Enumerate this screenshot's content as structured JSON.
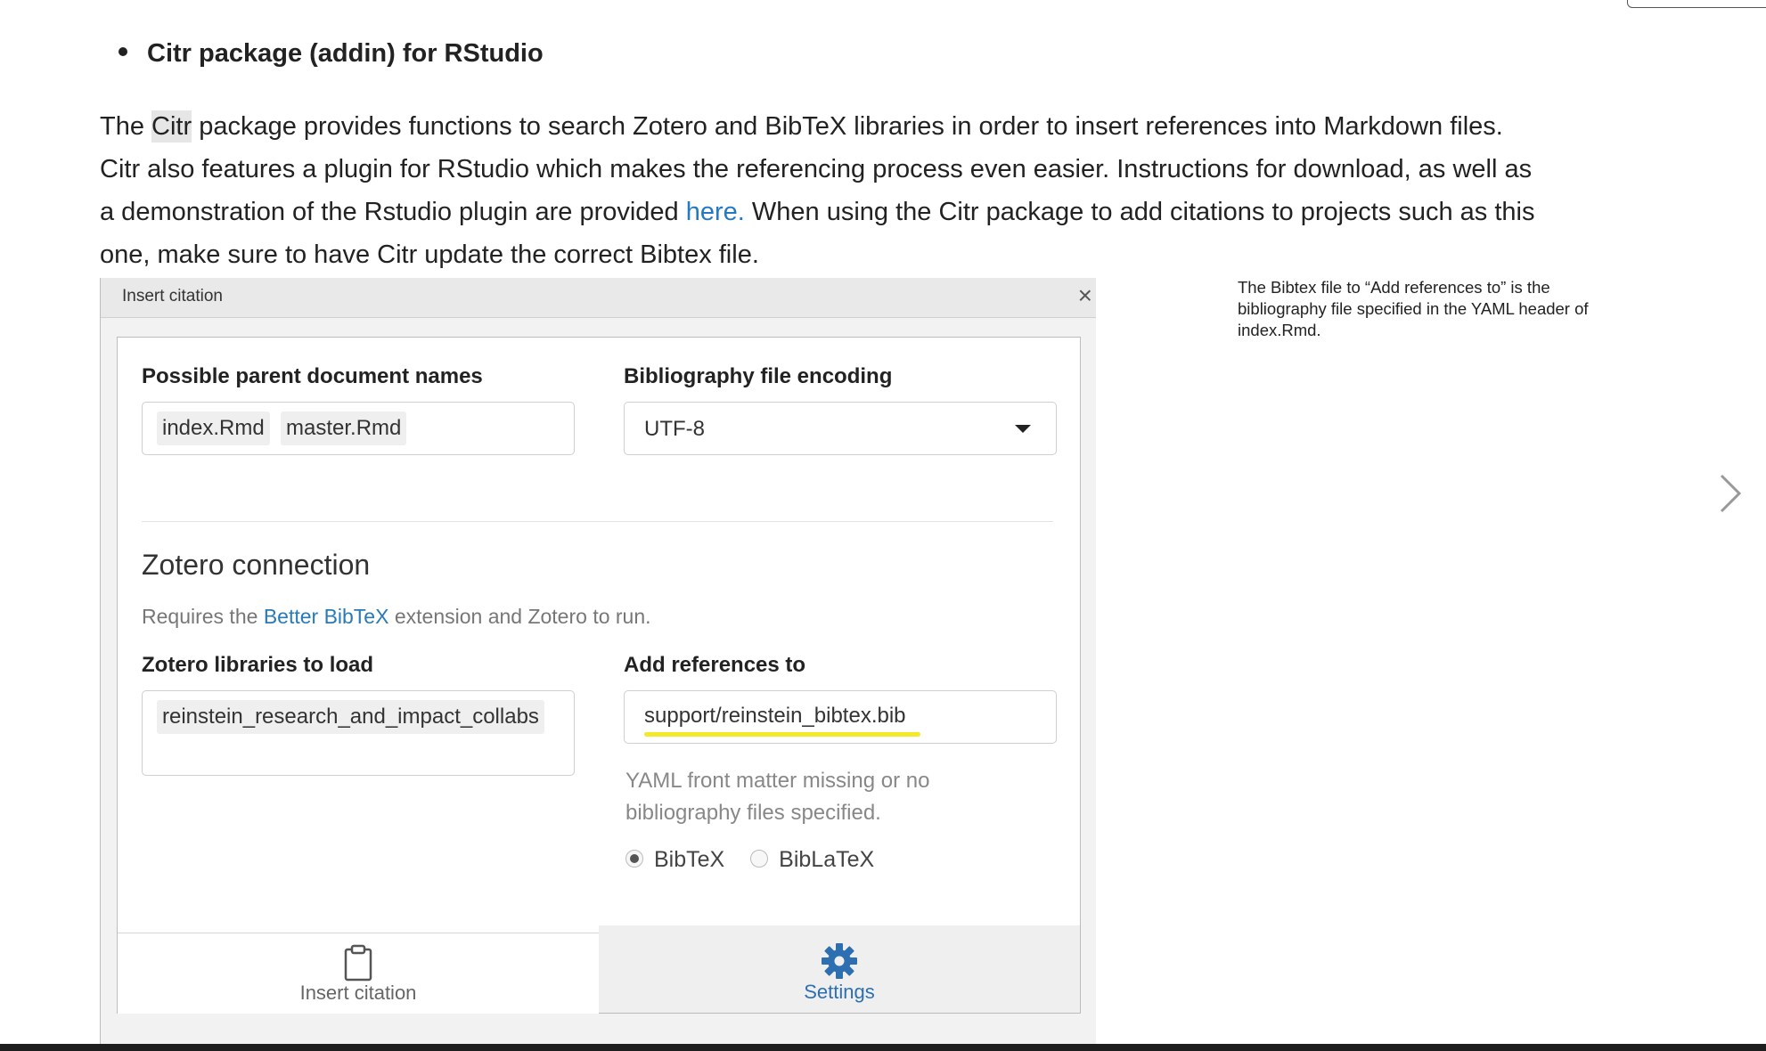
{
  "bullet": {
    "text": "Citr package (addin) for RStudio"
  },
  "paragraph": {
    "l1_pre": "The ",
    "l1_hl": "Citr",
    "l1_post": " package provides functions to search Zotero and BibTeX libraries in order to insert references into Markdown files.",
    "l2": "Citr also features a plugin for RStudio which makes the referencing process even easier. Instructions for download, as well as",
    "l3_pre": "a demonstration of the Rstudio plugin are provided ",
    "l3_link": "here.",
    "l3_post": " When using the Citr package to add citations to projects such as this",
    "l4": "one, make sure to have Citr update the correct Bibtex file."
  },
  "sidenote": "The Bibtex file to “Add references to” is the bibliography file specified in the YAML header of index.Rmd.",
  "dialog": {
    "title": "Insert citation",
    "close_symbol": "×",
    "parent_docs": {
      "label": "Possible parent document names",
      "chips": [
        "index.Rmd",
        "master.Rmd"
      ]
    },
    "encoding": {
      "label": "Bibliography file encoding",
      "value": "UTF-8"
    },
    "zotero": {
      "title": "Zotero connection",
      "desc_pre": "Requires the ",
      "desc_link": "Better BibTeX",
      "desc_post": " extension and Zotero to run."
    },
    "libraries": {
      "label": "Zotero libraries to load",
      "chips": [
        "reinstein_research_and_impact_collabs"
      ]
    },
    "add_refs": {
      "label": "Add references to",
      "value": "support/reinstein_bibtex.bib"
    },
    "yaml_note": "YAML front matter missing or no bibliography files specified.",
    "radios": [
      {
        "label": "BibTeX",
        "checked": true
      },
      {
        "label": "BibLaTeX",
        "checked": false
      }
    ],
    "tabs": {
      "insert": "Insert citation",
      "settings": "Settings"
    }
  },
  "colors": {
    "link": "#2479c2",
    "settings_tab": "#2d6fb0",
    "highlight_underline": "#f4e928"
  }
}
